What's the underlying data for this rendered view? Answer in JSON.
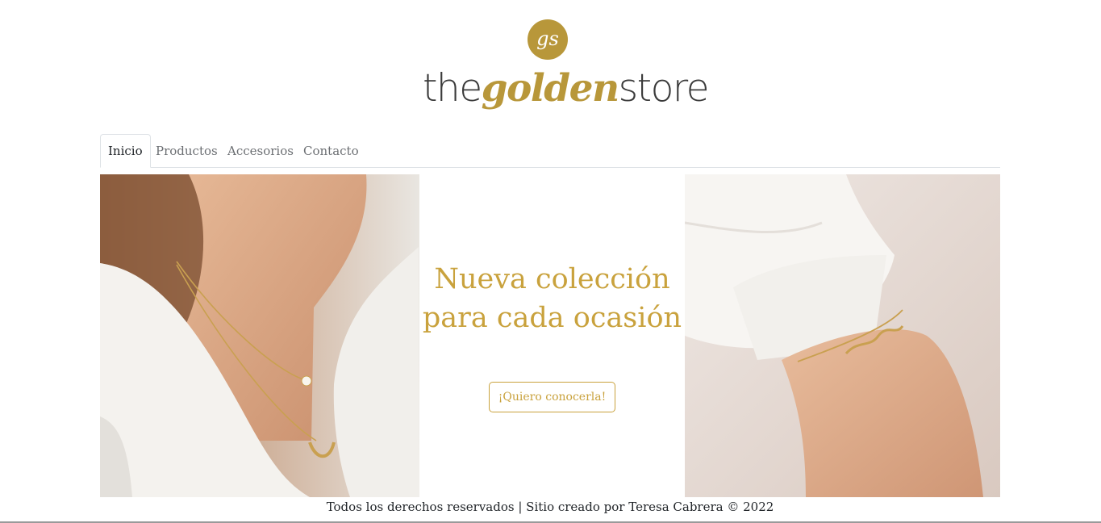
{
  "brand": {
    "monogram": "gs",
    "name_part1": "the",
    "name_part2": "golden",
    "name_part3": "store",
    "gold_color": "#b8973a",
    "dark_color": "#3a3a3a"
  },
  "nav": {
    "tabs": [
      {
        "label": "Inicio",
        "active": true
      },
      {
        "label": "Productos",
        "active": false
      },
      {
        "label": "Accesorios",
        "active": false
      },
      {
        "label": "Contacto",
        "active": false
      }
    ]
  },
  "hero": {
    "left_image": "model-wearing-layered-gold-necklaces",
    "right_image": "wrist-with-gold-name-bracelet",
    "title": "Nueva colección para cada ocasión",
    "button_label": "¡Quiero conocerla!",
    "accent_color": "#c9a23d"
  },
  "footer": {
    "text": "Todos los derechos reservados | Sitio creado por Teresa Cabrera © 2022"
  }
}
